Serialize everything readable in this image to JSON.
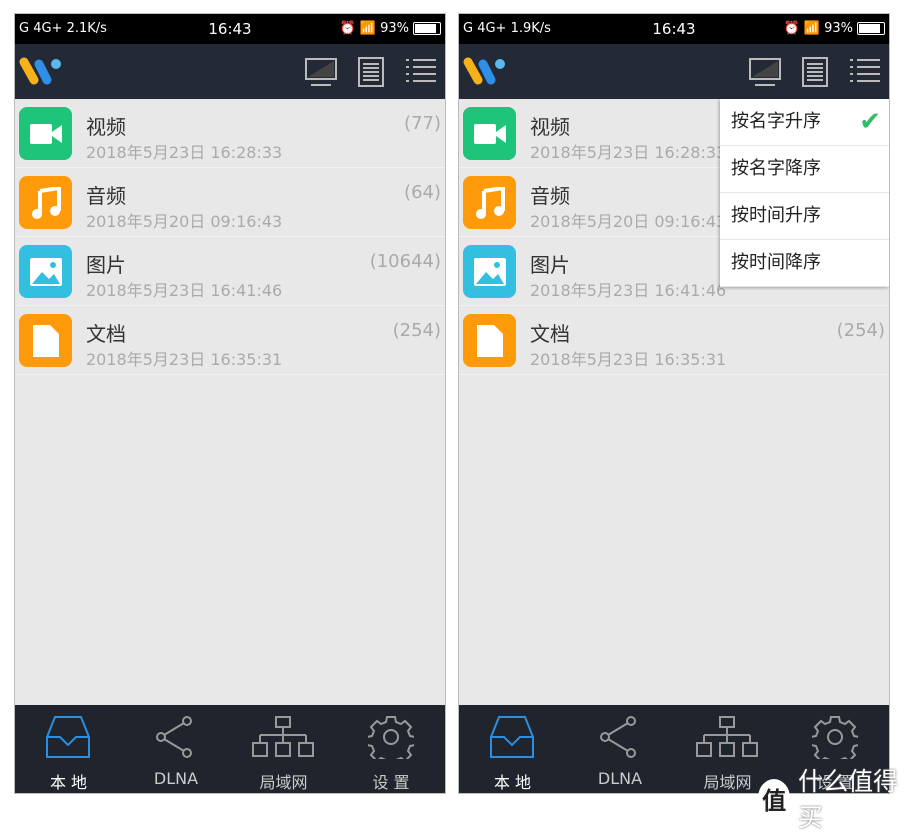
{
  "panels": [
    {
      "status": {
        "left": "G 4G+ 2.1K/s",
        "time": "16:43",
        "battery": "93%",
        "battery_level": 93
      },
      "sort_menu_open": false
    },
    {
      "status": {
        "left": "G 4G+ 1.9K/s",
        "time": "16:43",
        "battery": "93%",
        "battery_level": 93
      },
      "sort_menu_open": true
    }
  ],
  "header_icons": [
    "tv-icon",
    "document-icon",
    "list-icon"
  ],
  "categories": [
    {
      "name": "视频",
      "date": "2018年5月23日 16:28:33",
      "count": "(77)",
      "icon": "video-icon",
      "color": "#1dc47a"
    },
    {
      "name": "音频",
      "date": "2018年5月20日 09:16:43",
      "count": "(64)",
      "icon": "music-icon",
      "color": "#ff9b0a"
    },
    {
      "name": "图片",
      "date": "2018年5月23日 16:41:46",
      "count": "(10644)",
      "icon": "image-icon",
      "color": "#33c0e0"
    },
    {
      "name": "文档",
      "date": "2018年5月23日 16:35:31",
      "count": "(254)",
      "icon": "document-icon",
      "color": "#ff9b0a"
    }
  ],
  "sort_menu": [
    {
      "label": "按名字升序",
      "checked": true
    },
    {
      "label": "按名字降序",
      "checked": false
    },
    {
      "label": "按时间升序",
      "checked": false
    },
    {
      "label": "按时间降序",
      "checked": false
    }
  ],
  "check_glyph": "✔",
  "tabs": [
    {
      "label": "本 地",
      "icon": "inbox-icon",
      "active": true
    },
    {
      "label": "DLNA",
      "icon": "share-icon",
      "active": false
    },
    {
      "label": "局域网",
      "icon": "network-icon",
      "active": false
    },
    {
      "label": "设 置",
      "icon": "gear-icon",
      "active": false
    }
  ],
  "colors": {
    "accent": "#2a8fe0",
    "check": "#2ebd6b",
    "header": "#232a36",
    "nav": "#1f242d"
  },
  "watermark": {
    "logo": "值",
    "text": "什么值得买"
  }
}
